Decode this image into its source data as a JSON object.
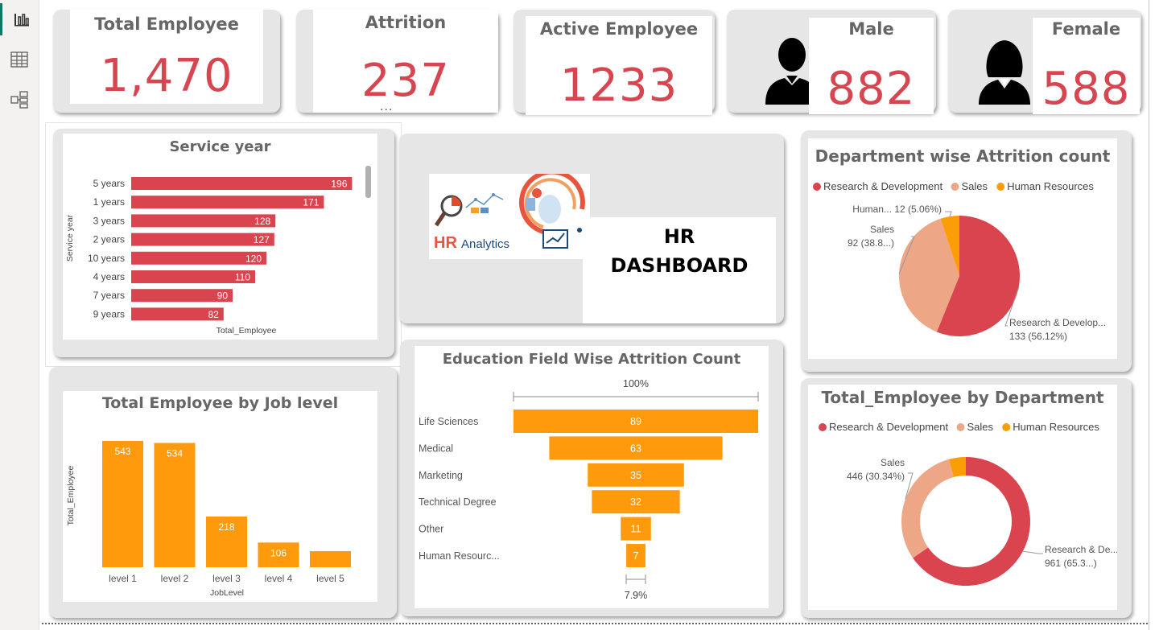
{
  "rail": {
    "icons": [
      "report-view-icon",
      "table-view-icon",
      "model-view-icon"
    ]
  },
  "kpis": {
    "total_employee": {
      "label": "Total Employee",
      "value": "1,470"
    },
    "attrition": {
      "label": "Attrition",
      "value": "237"
    },
    "active_employee": {
      "label": "Active Employee",
      "value": "1233"
    },
    "male": {
      "label": "Male",
      "value": "882"
    },
    "female": {
      "label": "Female",
      "value": "588"
    }
  },
  "more_options": "...",
  "service_year": {
    "title": "Service year",
    "xlabel": "Total_Employee",
    "ylabel": "Service year"
  },
  "logo": {
    "hr": "HR",
    "analytics": "Analytics"
  },
  "dashboard_title": {
    "line1": "HR",
    "line2": "DASHBOARD"
  },
  "dept_attrition": {
    "title": "Department wise Attrition count"
  },
  "job_level": {
    "title": "Total Employee by Job level",
    "xlabel": "JobLevel",
    "ylabel": "Total_Employee"
  },
  "education": {
    "title": "Education Field Wise Attrition Count",
    "top_pct": "100%",
    "bottom_pct": "7.9%"
  },
  "dept_employee": {
    "title": "Total_Employee by Department"
  },
  "colors": {
    "red": "#d9444f",
    "orange": "#ff9a0d",
    "salmon": "#eea786",
    "amber": "#fb9d07",
    "kpi": "#d64550"
  },
  "chart_data": [
    {
      "id": "service-year",
      "type": "bar",
      "orientation": "horizontal",
      "categories": [
        "5 years",
        "1 years",
        "3 years",
        "2 years",
        "10 years",
        "4 years",
        "7 years",
        "9 years"
      ],
      "values": [
        196,
        171,
        128,
        127,
        120,
        110,
        90,
        82
      ],
      "xlabel": "Total_Employee",
      "ylabel": "Service year",
      "xlim": [
        0,
        200
      ]
    },
    {
      "id": "dept-attrition",
      "type": "pie",
      "title": "Department wise Attrition count",
      "legend": [
        "Research & Development",
        "Sales",
        "Human Resources"
      ],
      "slices": [
        {
          "label": "Research & Development",
          "value": 133,
          "pct": 56.12,
          "text": "Research & Develop...",
          "value_text": "133 (56.12%)"
        },
        {
          "label": "Sales",
          "value": 92,
          "pct": 38.82,
          "text": "Sales",
          "value_text": "92 (38.8...)"
        },
        {
          "label": "Human Resources",
          "value": 12,
          "pct": 5.06,
          "text": "Human...",
          "value_text": "12 (5.06%)"
        }
      ]
    },
    {
      "id": "job-level",
      "type": "bar",
      "title": "Total Employee by Job level",
      "categories": [
        "level 1",
        "level 2",
        "level 3",
        "level 4",
        "level 5"
      ],
      "values": [
        543,
        534,
        218,
        106,
        69
      ],
      "labels": [
        "543",
        "534",
        "218",
        "106",
        ""
      ],
      "xlabel": "JobLevel",
      "ylabel": "Total_Employee",
      "ylim": [
        0,
        560
      ]
    },
    {
      "id": "education",
      "type": "bar",
      "subtype": "funnel",
      "title": "Education Field Wise Attrition Count",
      "categories": [
        "Life Sciences",
        "Medical",
        "Marketing",
        "Technical Degree",
        "Other",
        "Human Resourc..."
      ],
      "values": [
        89,
        63,
        35,
        32,
        11,
        7
      ]
    },
    {
      "id": "dept-employee",
      "type": "pie",
      "subtype": "donut",
      "title": "Total_Employee by Department",
      "legend": [
        "Research & Development",
        "Sales",
        "Human Resources"
      ],
      "slices": [
        {
          "label": "Research & Development",
          "value": 961,
          "pct": 65.37,
          "text": "Research & De...",
          "value_text": "961 (65.3...)"
        },
        {
          "label": "Sales",
          "value": 446,
          "pct": 30.34,
          "text": "Sales",
          "value_text": "446 (30.34%)"
        },
        {
          "label": "Human Resources",
          "value": 63,
          "pct": 4.29,
          "text": "",
          "value_text": ""
        }
      ]
    }
  ]
}
